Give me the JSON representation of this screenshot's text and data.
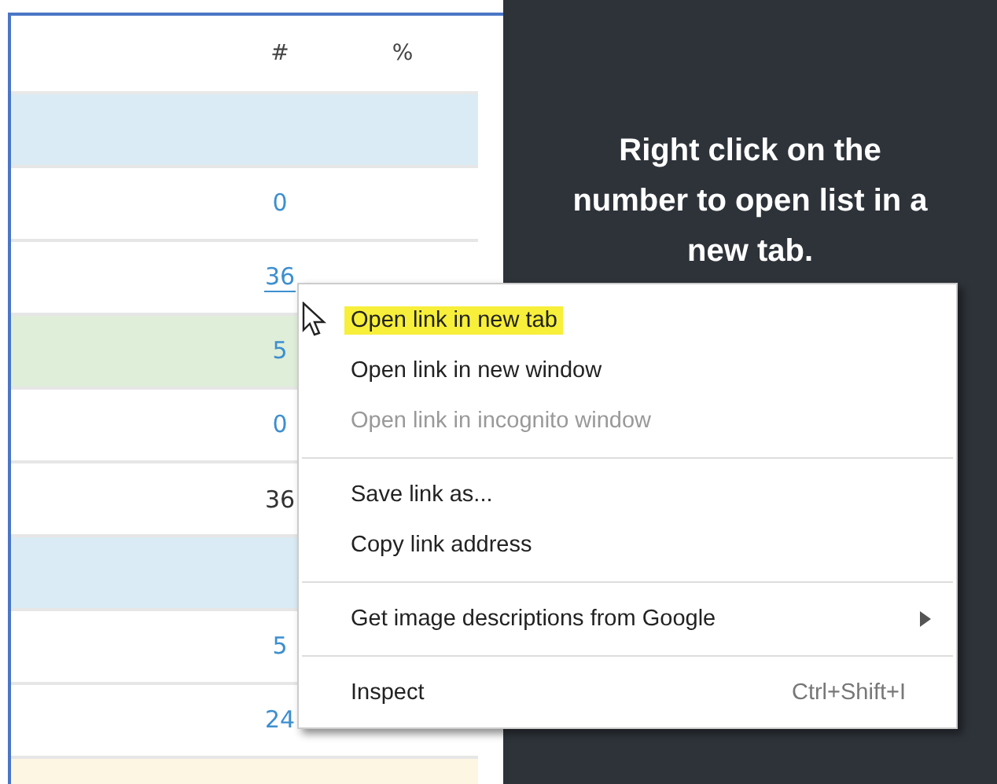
{
  "table": {
    "columns": [
      "#",
      "%"
    ],
    "rows": [
      {
        "color": "#daebf5"
      },
      {
        "count": "0",
        "kind": "link",
        "hovered": false
      },
      {
        "count": "36",
        "kind": "link",
        "hovered": true
      },
      {
        "color": "#dfeed9",
        "count": "5",
        "kind": "link",
        "hovered": false
      },
      {
        "count": "0",
        "kind": "link",
        "hovered": false
      },
      {
        "count": "36",
        "kind": "plain"
      },
      {
        "color": "#daebf5"
      },
      {
        "count": "5",
        "kind": "link",
        "hovered": false
      },
      {
        "count": "24",
        "kind": "link",
        "hovered": false
      },
      {
        "color": "#fcf6e3"
      }
    ]
  },
  "tip": {
    "text": "Right click on the number to open list in a new tab."
  },
  "context_menu": {
    "groups": [
      [
        {
          "label": "Open link in new tab",
          "selected": true,
          "disabled": false
        },
        {
          "label": "Open link in new window",
          "selected": false,
          "disabled": false
        },
        {
          "label": "Open link in incognito window",
          "selected": false,
          "disabled": true
        }
      ],
      [
        {
          "label": "Save link as...",
          "selected": false,
          "disabled": false
        },
        {
          "label": "Copy link address",
          "selected": false,
          "disabled": false
        }
      ],
      [
        {
          "label": "Get image descriptions from Google",
          "selected": false,
          "disabled": false,
          "submenu": true
        }
      ],
      [
        {
          "label": "Inspect",
          "selected": false,
          "disabled": false,
          "shortcut": "Ctrl+Shift+I"
        }
      ]
    ]
  }
}
